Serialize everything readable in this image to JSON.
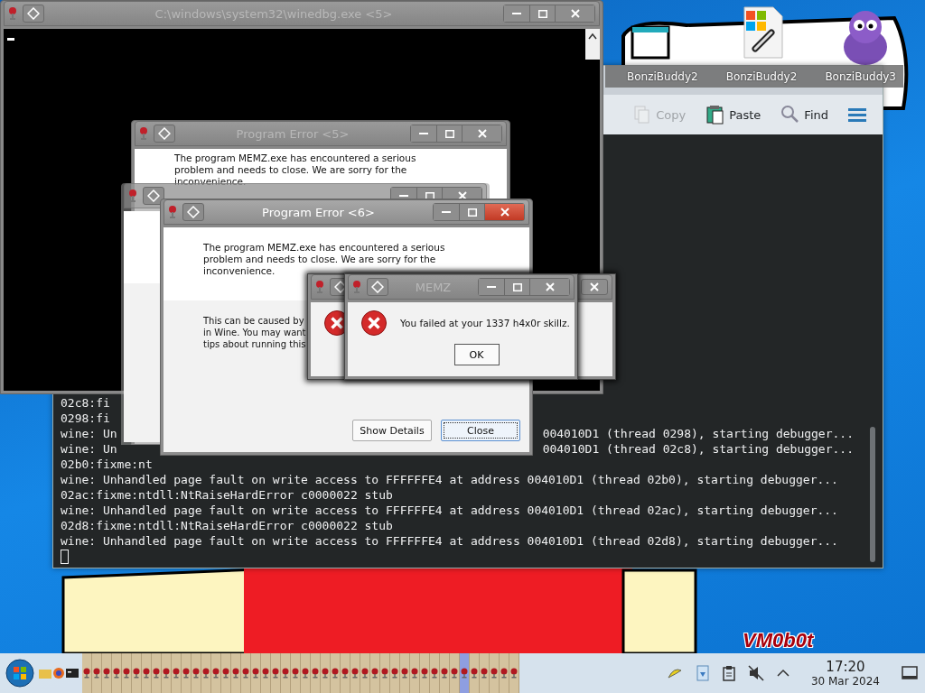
{
  "desktop": {
    "label": "VM0b0t"
  },
  "terminal": {
    "toolbar": [
      {
        "kind": "copy",
        "label": "Copy",
        "disabled": true
      },
      {
        "kind": "paste",
        "label": "Paste",
        "disabled": false
      },
      {
        "kind": "find",
        "label": "Find",
        "disabled": false
      }
    ],
    "lines": [
      {
        "left": "02c8:fi"
      },
      {
        "left": "0298:fi"
      },
      {
        "left": "wine: Un",
        "right": "004010D1 (thread 0298), starting debugger..."
      },
      {
        "left": "wine: Un",
        "right": "004010D1 (thread 02c8), starting debugger..."
      },
      {
        "left": "02b0:fixme:nt"
      },
      {
        "left": "wine: Unhandled page fault on write access to FFFFFFE4 at address 004010D1 (thread 02b0), starting debugger..."
      },
      {
        "left": "02ac:fixme:ntdll:NtRaiseHardError c0000022 stub"
      },
      {
        "left": "wine: Unhandled page fault on write access to FFFFFFE4 at address 004010D1 (thread 02ac), starting debugger..."
      },
      {
        "left": "02d8:fixme:ntdll:NtRaiseHardError c0000022 stub"
      },
      {
        "left": "wine: Unhandled page fault on write access to FFFFFFE4 at address 004010D1 (thread 02d8), starting debugger..."
      }
    ]
  },
  "bonzi_windows": [
    {
      "title": "BonziBuddy2"
    },
    {
      "title": "BonziBuddy2"
    },
    {
      "title": "BonziBuddy3"
    }
  ],
  "console_window": {
    "title": "C:\\windows\\system32\\winedbg.exe <5>"
  },
  "error_5": {
    "title": "Program Error <5>",
    "message": "The program MEMZ.exe has encountered a serious problem and needs to close. We are sorry for the inconvenience."
  },
  "error_6": {
    "title": "Program Error <6>",
    "message": "The program MEMZ.exe has encountered a serious problem and needs to close. We are sorry for the inconvenience.",
    "details": [
      "This can be caused by",
      "in Wine. You may want",
      "tips about running this"
    ],
    "buttons": [
      {
        "label": "Show Details",
        "focused": false
      },
      {
        "label": "Close",
        "focused": true
      }
    ]
  },
  "memz": {
    "title": "MEMZ",
    "message": "You failed at your 1337 h4x0r skillz.",
    "button": "OK"
  },
  "taskbar": {
    "tasks": [
      {
        "selected": false
      },
      {
        "selected": false
      },
      {
        "selected": false
      },
      {
        "selected": false
      },
      {
        "selected": false
      },
      {
        "selected": false
      },
      {
        "selected": false
      },
      {
        "selected": false
      },
      {
        "selected": false
      },
      {
        "selected": false
      },
      {
        "selected": false
      },
      {
        "selected": false
      },
      {
        "selected": false
      },
      {
        "selected": false
      },
      {
        "selected": false
      },
      {
        "selected": false
      },
      {
        "selected": false
      },
      {
        "selected": false
      },
      {
        "selected": false
      },
      {
        "selected": false
      },
      {
        "selected": false
      },
      {
        "selected": false
      },
      {
        "selected": false
      },
      {
        "selected": false
      },
      {
        "selected": false
      },
      {
        "selected": false
      },
      {
        "selected": false
      },
      {
        "selected": false
      },
      {
        "selected": false
      },
      {
        "selected": false
      },
      {
        "selected": false
      },
      {
        "selected": false
      },
      {
        "selected": false
      },
      {
        "selected": false
      },
      {
        "selected": false
      },
      {
        "selected": false
      },
      {
        "selected": false
      },
      {
        "selected": false
      },
      {
        "selected": true
      },
      {
        "selected": false
      },
      {
        "selected": false
      },
      {
        "selected": false
      },
      {
        "selected": false
      },
      {
        "selected": false
      }
    ],
    "time": "17:20",
    "date": "30 Mar 2024"
  }
}
